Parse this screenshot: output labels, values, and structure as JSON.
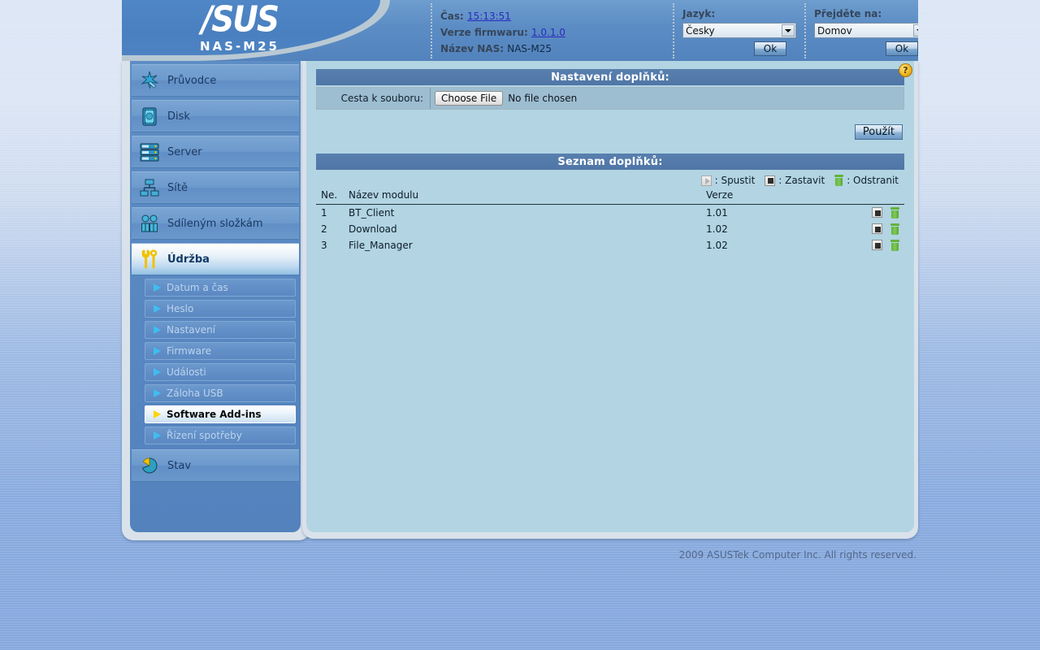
{
  "brand": {
    "logo_text": "/SUS",
    "model": "NAS-M25"
  },
  "header": {
    "time_label": "Čas:",
    "time_value": "15:13:51",
    "firmware_label": "Verze firmwaru:",
    "firmware_value": "1.0.1.0",
    "nas_label": "Název NAS:",
    "nas_value": "NAS-M25",
    "language_label": "Jazyk:",
    "language_value": "Česky",
    "language_ok": "Ok",
    "goto_label": "Přejděte na:",
    "goto_value": "Domov",
    "goto_ok": "Ok"
  },
  "sidebar": {
    "items": [
      {
        "label": "Průvodce",
        "icon": "wizard-icon",
        "active": false
      },
      {
        "label": "Disk",
        "icon": "disk-icon",
        "active": false
      },
      {
        "label": "Server",
        "icon": "server-icon",
        "active": false
      },
      {
        "label": "Sítě",
        "icon": "network-icon",
        "active": false
      },
      {
        "label": "Sdíleným složkám",
        "icon": "shared-folders-icon",
        "active": false
      },
      {
        "label": "Údržba",
        "icon": "maintenance-icon",
        "active": true
      }
    ],
    "subitems": [
      {
        "label": "Datum a čas",
        "active": false
      },
      {
        "label": "Heslo",
        "active": false
      },
      {
        "label": "Nastavení",
        "active": false
      },
      {
        "label": "Firmware",
        "active": false
      },
      {
        "label": "Události",
        "active": false
      },
      {
        "label": "Záloha USB",
        "active": false
      },
      {
        "label": "Software Add-ins",
        "active": true
      },
      {
        "label": "Řízení spotřeby",
        "active": false
      }
    ],
    "status_item": {
      "label": "Stav",
      "icon": "status-icon"
    }
  },
  "main": {
    "settings_title": "Nastavení doplňků:",
    "help_glyph": "?",
    "file_path_label": "Cesta k souboru:",
    "choose_file_label": "Choose File",
    "no_file_text": "No file chosen",
    "apply_label": "Použít",
    "list_title": "Seznam doplňků:",
    "legend": {
      "start": ": Spustit",
      "stop": ": Zastavit",
      "delete": ": Odstranit"
    },
    "columns": {
      "no": "Ne.",
      "name": "Název modulu",
      "version": "Verze"
    },
    "rows": [
      {
        "no": "1",
        "name": "BT_Client",
        "version": "1.01"
      },
      {
        "no": "2",
        "name": "Download",
        "version": "1.02"
      },
      {
        "no": "3",
        "name": "File_Manager",
        "version": "1.02"
      }
    ]
  },
  "footer": {
    "copyright": "2009 ASUSTek Computer Inc. All rights reserved."
  }
}
